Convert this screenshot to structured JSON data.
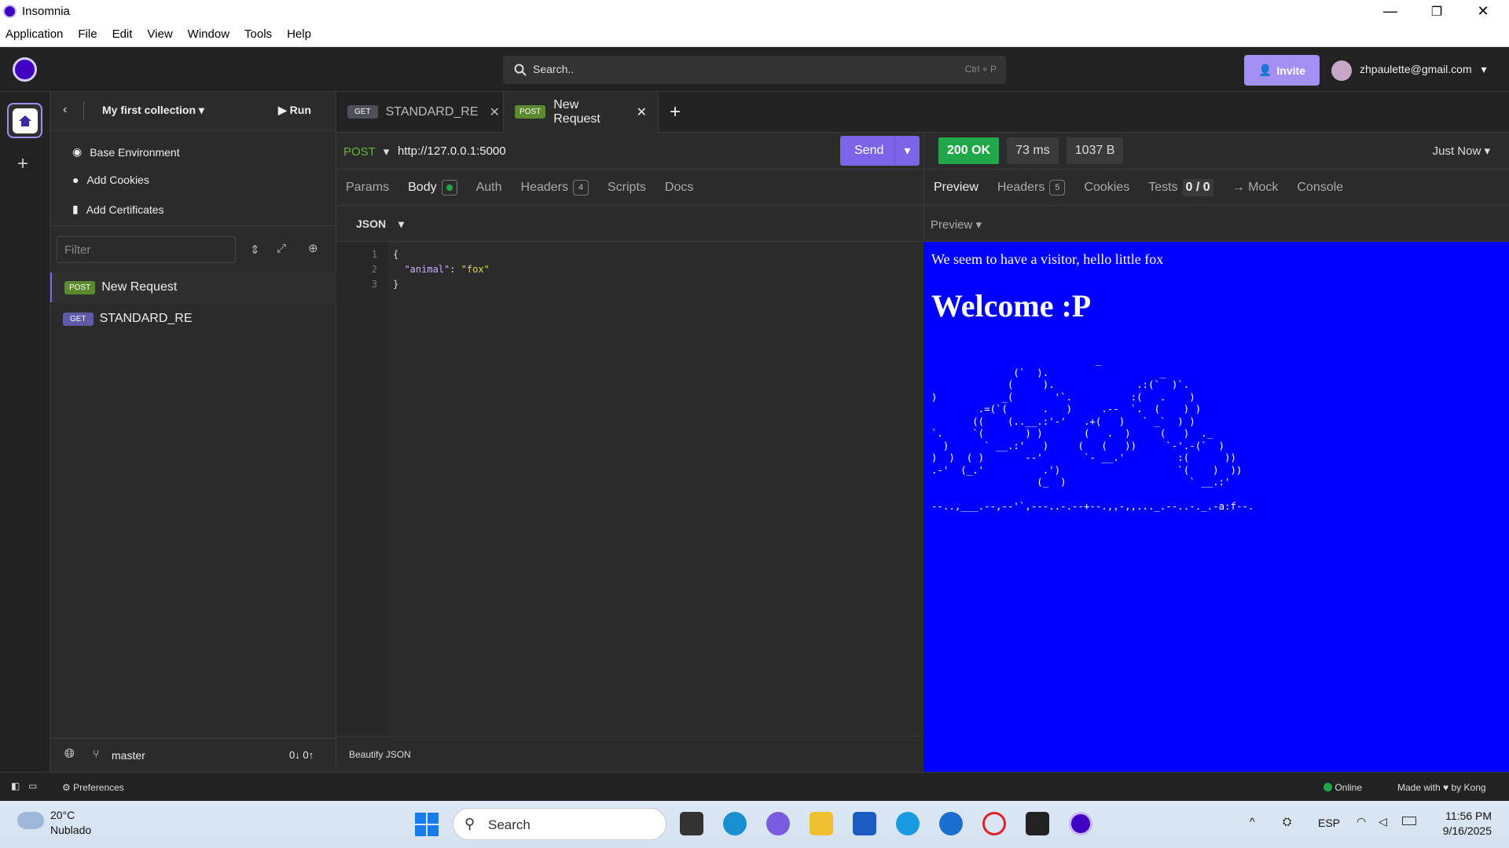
{
  "window": {
    "title": "Insomnia",
    "min": "—",
    "max": "❐",
    "close": "✕"
  },
  "menu": [
    "Application",
    "File",
    "Edit",
    "View",
    "Window",
    "Tools",
    "Help"
  ],
  "header": {
    "search_label": "Search..",
    "search_hint": "Ctrl + P",
    "invite": "Invite",
    "user_email": "zhpaulette@gmail.com"
  },
  "sidebar": {
    "collection": "My first collection",
    "run": "Run",
    "items": [
      "Base Environment",
      "Add Cookies",
      "Add Certificates"
    ],
    "filter_placeholder": "Filter",
    "requests": [
      {
        "method": "POST",
        "name": "New Request"
      },
      {
        "method": "GET",
        "name": "STANDARD_RE"
      }
    ],
    "branch": "master",
    "sync": "0↓ 0↑"
  },
  "tabs": [
    {
      "method": "GET",
      "name": "STANDARD_RE"
    },
    {
      "method": "POST",
      "name": "New Request"
    }
  ],
  "request": {
    "method": "POST",
    "url": "http://127.0.0.1:5000",
    "send": "Send",
    "tabs": {
      "params": "Params",
      "body": "Body",
      "auth": "Auth",
      "headers": "Headers",
      "headers_count": "4",
      "scripts": "Scripts",
      "docs": "Docs"
    },
    "body_type": "JSON",
    "code_lines": [
      "{",
      "  \"animal\": \"fox\"",
      "}"
    ],
    "line_numbers": [
      "1",
      "2",
      "3"
    ],
    "beautify": "Beautify JSON"
  },
  "response": {
    "status": "200 OK",
    "time": "73 ms",
    "size": "1037 B",
    "when": "Just Now",
    "tabs": {
      "preview": "Preview",
      "headers": "Headers",
      "headers_count": "5",
      "cookies": "Cookies",
      "tests": "Tests",
      "tests_count": "0 / 0",
      "mock": "→ Mock",
      "console": "Console"
    },
    "preview_mode": "Preview",
    "line1": "We seem to have a visitor, hello little fox",
    "heading": "Welcome :P",
    "ascii": "                            _\n              (`  ).                   _\n             (     ).              .:(`  )`.\n)           _(       '`.          :(   .    )\n        .=(`(      .   )     .--  `.  (    ) )\n       ((    (..__.:'-'   .+(   )   ` _`  ) )\n`.     `(       ) )       (   .  )     (   )  ._\n  )      ` __.:'   )     (   (   ))     `-'.-(`  )\n)  )  ( )       --'       `- __.'         :(      ))\n.-'  (_.'          .')                    `(    )  ))\n                  (_  )                     ` __.:'\n\n--..,___.--,--'`,---..-.--+--.,,-,,..._.--..-._.-a:f--."
  },
  "status": {
    "preferences": "Preferences",
    "online": "Online",
    "made_with": "Made with",
    "by": "by Kong"
  },
  "taskbar": {
    "temp": "20°C",
    "weather": "Nublado",
    "search": "Search",
    "lang": "ESP",
    "time": "11:56 PM",
    "date": "9/16/2025"
  },
  "colors": {
    "accent": "#7b65e6",
    "ok": "#1fa74a",
    "preview_bg": "#0000ff",
    "post": "#5c8a2e",
    "get": "#5f5aa5"
  }
}
